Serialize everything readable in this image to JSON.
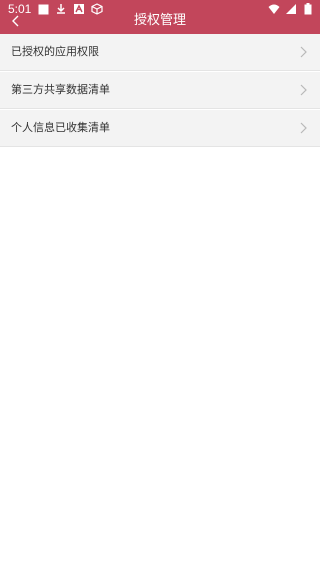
{
  "status_bar": {
    "time": "5:01",
    "left_icons": [
      "square-notification-icon",
      "download-icon",
      "accessibility-icon",
      "box-icon"
    ],
    "right_icons": [
      "wifi-icon",
      "signal-icon",
      "battery-icon"
    ]
  },
  "header": {
    "title": "授权管理",
    "back_icon": "chevron-left-icon",
    "color": "#c2465b"
  },
  "menu": {
    "items": [
      {
        "label": "已授权的应用权限"
      },
      {
        "label": "第三方共享数据清单"
      },
      {
        "label": "个人信息已收集清单"
      }
    ]
  }
}
